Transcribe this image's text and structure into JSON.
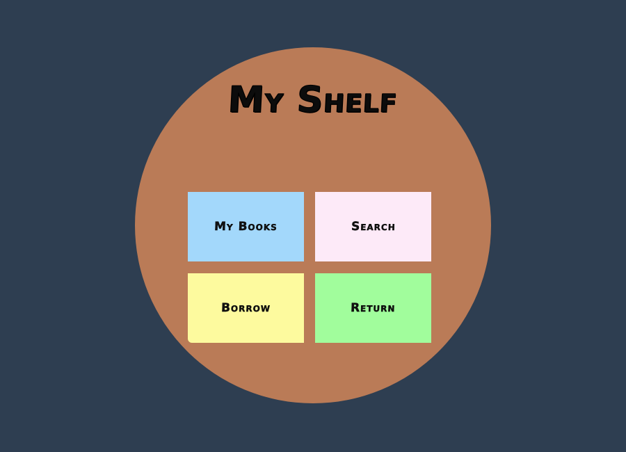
{
  "app": {
    "title": "My Shelf"
  },
  "colors": {
    "background": "#2e3e51",
    "circle": "#ba7b57",
    "title_text": "#0c0c0c"
  },
  "menu": {
    "items": [
      {
        "label": "My Books",
        "color": "#a3d8fb"
      },
      {
        "label": "Search",
        "color": "#fdeaf8"
      },
      {
        "label": "Borrow",
        "color": "#fdfa9e"
      },
      {
        "label": "Return",
        "color": "#a1fd9c"
      }
    ]
  }
}
